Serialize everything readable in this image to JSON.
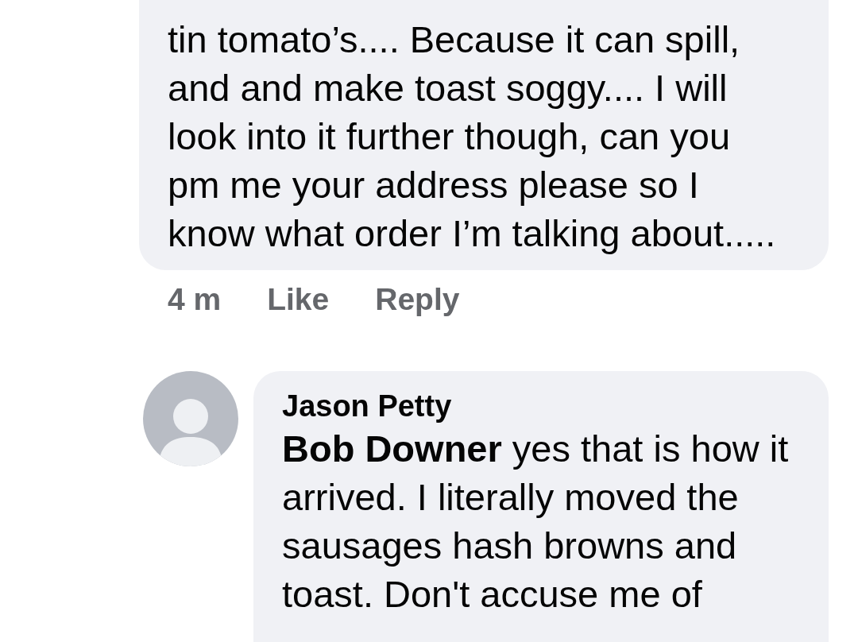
{
  "comments": [
    {
      "kind": "text-only",
      "lines": [
        "tin tomato’s.... Because it can spill,",
        "and and make toast soggy.... I will",
        "look into it further though, can you",
        "pm me your address please so I",
        "know what order I’m talking about....."
      ],
      "time": "4 m",
      "actions": [
        "Like",
        "Reply"
      ]
    },
    {
      "kind": "with-author",
      "author": "Jason Petty",
      "lines": [
        "**Bob Downer** yes that is how it",
        "arrived. I literally moved the",
        "sausages hash browns and",
        "toast. Don't accuse me of"
      ]
    }
  ]
}
